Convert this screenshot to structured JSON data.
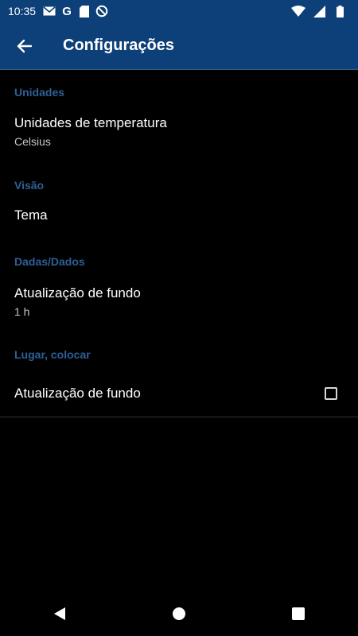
{
  "statusbar": {
    "time": "10:35"
  },
  "appbar": {
    "title": "Configurações"
  },
  "settings": {
    "units_header": "Unidades",
    "temperature_label": "Unidades de temperatura",
    "temperature_value": "Celsius",
    "vision_header": "Visão",
    "theme_label": "Tema",
    "data_header": "Dadas/Dados",
    "background_update_label": "Atualização de fundo",
    "background_update_value": "1 h",
    "place_header": "Lugar, colocar",
    "place_background_update_label": "Atualização de fundo",
    "place_background_update_checked": false
  },
  "colors": {
    "primary": "#0d3f78",
    "section_header": "#2e5f97",
    "background": "#000000"
  }
}
